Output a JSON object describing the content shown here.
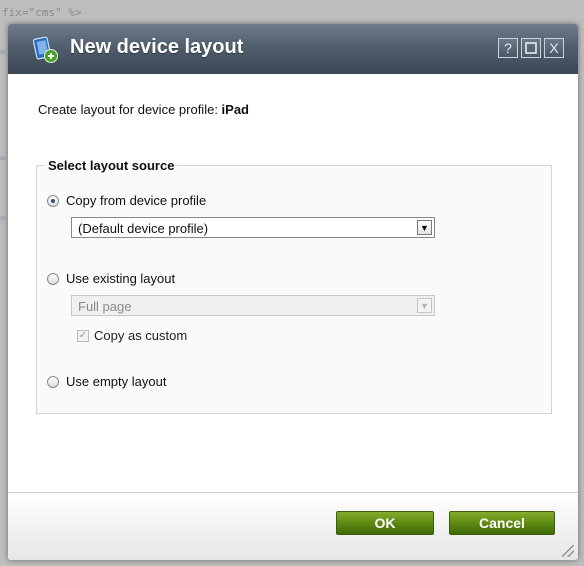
{
  "background": {
    "code_line": "fix=\"cms\" %>"
  },
  "dialog": {
    "title": "New device layout",
    "title_buttons": {
      "help": "?",
      "maximize": "□",
      "close": "X"
    },
    "intro_prefix": "Create layout for device profile: ",
    "device_profile": "iPad",
    "fieldset_legend": "Select layout source",
    "options": {
      "copy_from_profile": {
        "label": "Copy from device profile",
        "checked": true
      },
      "profile_select_value": "(Default device profile)",
      "use_existing": {
        "label": "Use existing layout",
        "checked": false
      },
      "layout_select_value": "Full page",
      "copy_as_custom": {
        "label": "Copy as custom",
        "checked": true,
        "disabled": true
      },
      "use_empty": {
        "label": "Use empty layout",
        "checked": false
      }
    },
    "buttons": {
      "ok": "OK",
      "cancel": "Cancel"
    }
  },
  "colors": {
    "titlebar": "#4f5c6b",
    "button_green": "#5e8a13"
  }
}
